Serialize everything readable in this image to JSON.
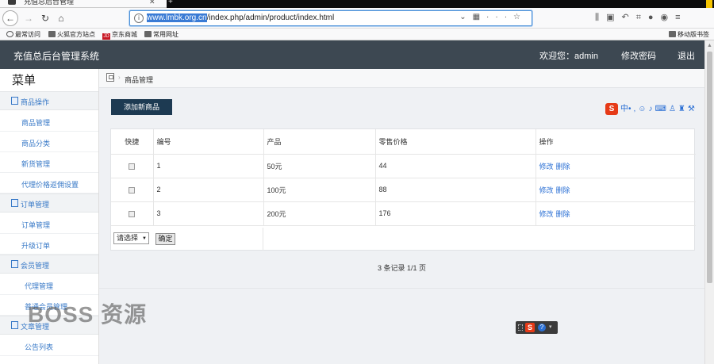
{
  "browser": {
    "tab_title": "充值总后台管理",
    "url_highlighted": "www.lmbk.org.cn",
    "url_rest": "/index.php/admin/product/index.html",
    "bookmarks": [
      "最常访问",
      "火狐官方站点",
      "京东商城",
      "常用网址"
    ],
    "mobile_bookmarks": "移动版书签",
    "jd_logo": "JD"
  },
  "header": {
    "title": "充值总后台管理系统",
    "welcome": "欢迎您：admin",
    "change_password": "修改密码",
    "logout": "退出"
  },
  "sidebar": {
    "menu_title": "菜单",
    "groups": [
      {
        "label": "商品操作",
        "items": [
          "商品管理",
          "商品分类",
          "新货管理",
          "代理价格返佣设置"
        ]
      },
      {
        "label": "订单管理",
        "items": [
          "订单管理",
          "升级订单"
        ]
      },
      {
        "label": "会员管理",
        "items": [
          "代理管理",
          "普通会员管理"
        ]
      },
      {
        "label": "文章管理",
        "items": [
          "公告列表"
        ]
      }
    ]
  },
  "breadcrumb": {
    "current": "商品管理"
  },
  "toolbar": {
    "add_button": "添加新商品"
  },
  "ime": {
    "logo": "S",
    "mode": "中"
  },
  "table": {
    "headers": [
      "快捷",
      "编号",
      "产品",
      "零售价格",
      "操作"
    ],
    "rows": [
      {
        "id": "1",
        "product": "50元",
        "price": "44"
      },
      {
        "id": "2",
        "product": "100元",
        "price": "88"
      },
      {
        "id": "3",
        "product": "200元",
        "price": "176"
      }
    ],
    "edit_label": "修改",
    "delete_label": "删除",
    "batch_select": "请选择",
    "batch_ok": "确定"
  },
  "pager": {
    "summary": "3 条记录 1/1 页"
  },
  "watermark": "BOSS 资源"
}
